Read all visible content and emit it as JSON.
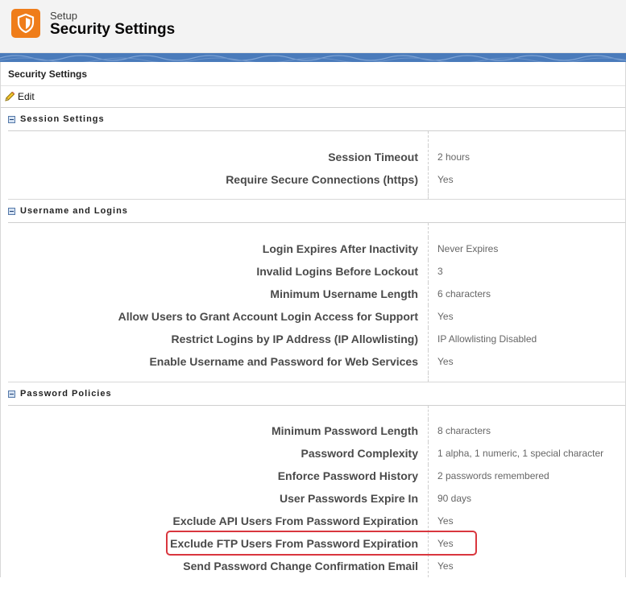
{
  "header": {
    "subtitle": "Setup",
    "title": "Security Settings"
  },
  "page": {
    "title": "Security Settings"
  },
  "toolbar": {
    "edit_label": "Edit"
  },
  "sections": [
    {
      "title": "Session Settings",
      "rows": [
        {
          "label": "Session Timeout",
          "value": "2 hours"
        },
        {
          "label": "Require Secure Connections (https)",
          "value": "Yes"
        }
      ]
    },
    {
      "title": "Username and Logins",
      "rows": [
        {
          "label": "Login Expires After Inactivity",
          "value": "Never Expires"
        },
        {
          "label": "Invalid Logins Before Lockout",
          "value": "3"
        },
        {
          "label": "Minimum Username Length",
          "value": "6 characters"
        },
        {
          "label": "Allow Users to Grant Account Login Access for Support",
          "value": "Yes"
        },
        {
          "label": "Restrict Logins by IP Address (IP Allowlisting)",
          "value": "IP Allowlisting Disabled"
        },
        {
          "label": "Enable Username and Password for Web Services",
          "value": "Yes"
        }
      ]
    },
    {
      "title": "Password Policies",
      "rows": [
        {
          "label": "Minimum Password Length",
          "value": "8 characters"
        },
        {
          "label": "Password Complexity",
          "value": "1 alpha, 1 numeric, 1 special character"
        },
        {
          "label": "Enforce Password History",
          "value": "2 passwords remembered"
        },
        {
          "label": "User Passwords Expire In",
          "value": "90 days"
        },
        {
          "label": "Exclude API Users From Password Expiration",
          "value": "Yes"
        },
        {
          "label": "Exclude FTP Users From Password Expiration",
          "value": "Yes"
        },
        {
          "label": "Send Password Change Confirmation Email",
          "value": "Yes"
        }
      ]
    }
  ],
  "colors": {
    "brand_orange": "#ef7d1a",
    "banner_blue": "#4a7bbb",
    "highlight_red": "#d9363e"
  },
  "icons": {
    "logo": "shield-icon",
    "edit": "pencil-icon",
    "section_toggle": "collapse-icon"
  }
}
